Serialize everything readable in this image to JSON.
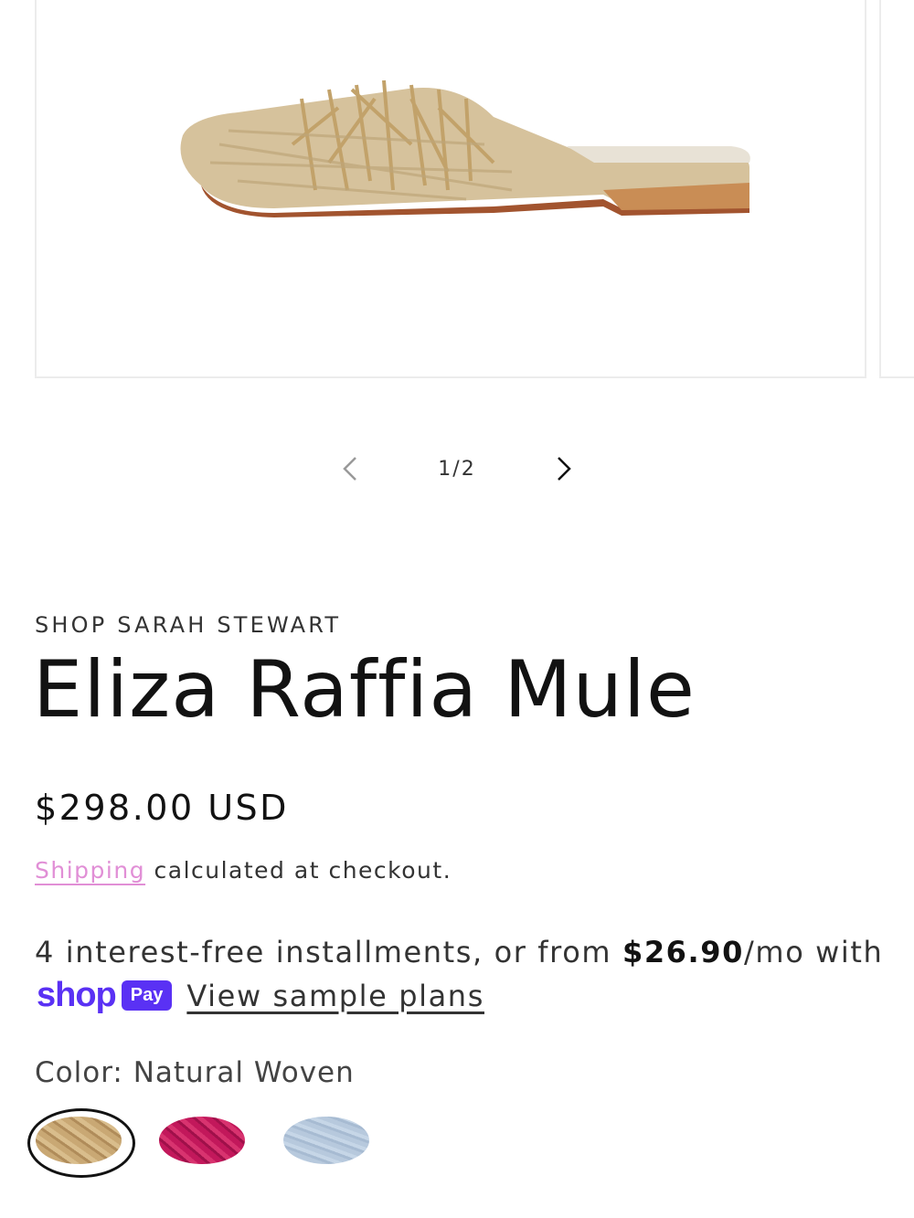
{
  "gallery": {
    "image_alt": "Eliza Raffia Mule",
    "counter": "1/2",
    "prev_icon": "chevron-left-icon",
    "next_icon": "chevron-right-icon"
  },
  "product": {
    "vendor": "SHOP SARAH STEWART",
    "title": "Eliza Raffia Mule",
    "price": "$298.00 USD"
  },
  "shipping": {
    "link_text": "Shipping",
    "rest_text": " calculated at checkout."
  },
  "installments": {
    "prefix": "4 interest-free installments, or from ",
    "amount": "$26.90",
    "suffix": "/mo with",
    "shop_word": "shop",
    "pay_badge": "Pay",
    "link_text": "View sample plans"
  },
  "color": {
    "label": "Color: Natural Woven",
    "swatches": [
      "Natural Woven",
      "Pink",
      "Blue"
    ],
    "selected": "Natural Woven"
  },
  "colors": {
    "link_pink": "#e18fd6",
    "shop_pay_purple": "#5a31f4"
  }
}
